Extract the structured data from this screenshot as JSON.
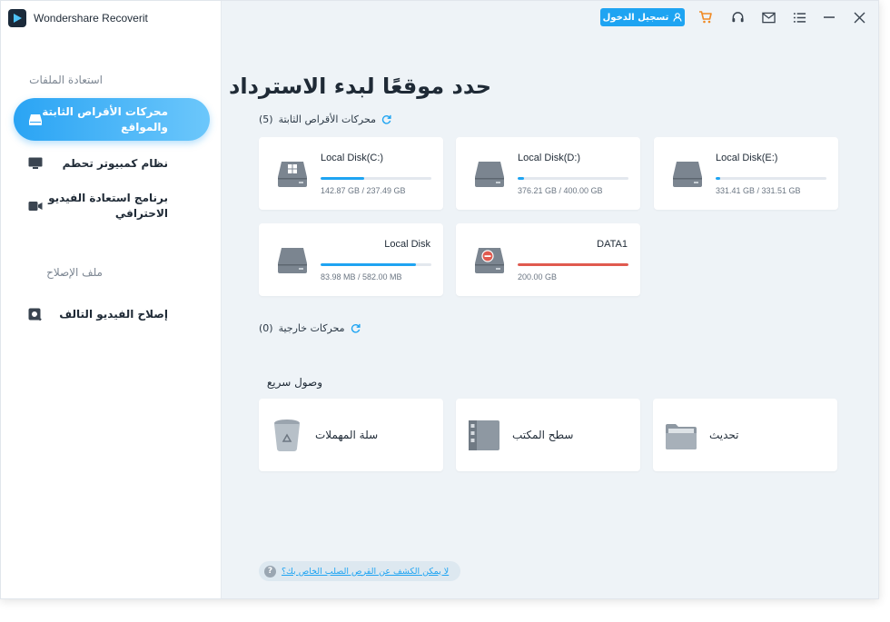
{
  "app": {
    "title": "Wondershare Recoverit"
  },
  "titlebar": {
    "login_label": "تسجيل الدخول"
  },
  "sidebar": {
    "recovery_section": "استعادة الملفات",
    "items": [
      {
        "label": "محركات الأقراص الثابتة والمواقع",
        "icon": "hard-drive-icon",
        "active": true
      },
      {
        "label": "نظام كمبيوتر تحطم",
        "icon": "monitor-icon",
        "active": false
      },
      {
        "label": "برنامج استعادة الفيديو الاحترافي",
        "icon": "video-camera-icon",
        "active": false
      }
    ],
    "repair_section": "ملف الإصلاح",
    "repair_items": [
      {
        "label": "إصلاح الفيديو التالف",
        "icon": "video-repair-icon"
      }
    ]
  },
  "main": {
    "heading": "حدد موقعًا لبدء الاسترداد",
    "hard_drives": {
      "label": "محركات الأقراص الثابتة",
      "count": "(5)",
      "disks": [
        {
          "name": "Local Disk(C:)",
          "size": "142.87 GB / 237.49 GB",
          "usage": 0.39,
          "status": "normal",
          "windows": true
        },
        {
          "name": "Local Disk(D:)",
          "size": "376.21 GB / 400.00 GB",
          "usage": 0.06,
          "status": "normal",
          "windows": false
        },
        {
          "name": "Local Disk(E:)",
          "size": "331.41 GB / 331.51 GB",
          "usage": 0.04,
          "status": "normal",
          "windows": false
        },
        {
          "name": "Local Disk",
          "size": "83.98 MB / 582.00 MB",
          "usage": 0.86,
          "status": "normal",
          "windows": false
        },
        {
          "name": "DATA1",
          "size": "200.00 GB",
          "usage": 1.0,
          "status": "error",
          "windows": false
        }
      ]
    },
    "external_drives": {
      "label": "محركات خارجية",
      "count": "(0)"
    },
    "quick_access": {
      "label": "وصول سريع",
      "items": [
        {
          "label": "سلة المهملات",
          "icon": "recycle-bin-icon"
        },
        {
          "label": "سطح المكتب",
          "icon": "desktop-icon"
        },
        {
          "label": "تحديث",
          "icon": "folder-icon"
        }
      ]
    },
    "help_link": "لا يمكن الكشف عن القرص الصلب الخاص بك؟"
  },
  "colors": {
    "accent": "#1ea4f2",
    "error": "#e05a4f",
    "bar_bg": "#e3e8ee"
  }
}
